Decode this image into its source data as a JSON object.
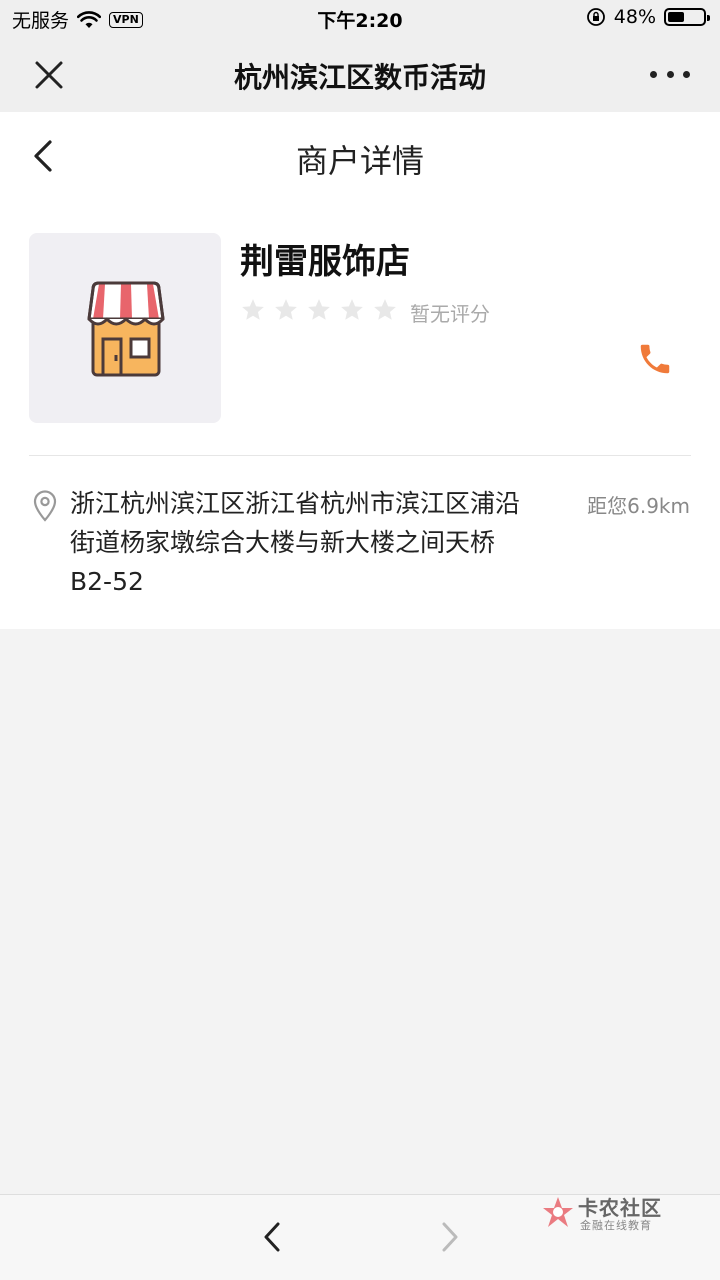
{
  "status_bar": {
    "carrier": "无服务",
    "vpn": "VPN",
    "time": "下午2:20",
    "battery_text": "48%",
    "battery_level": 0.48
  },
  "title_bar": {
    "title": "杭州滨江区数币活动",
    "close_icon": "close-icon",
    "more_icon": "more-icon"
  },
  "page": {
    "title": "商户详情"
  },
  "store": {
    "name": "荆雷服饰店",
    "rating_label": "暂无评分",
    "rating_stars": 0,
    "max_stars": 5,
    "address": "浙江杭州滨江区浙江省杭州市滨江区浦沿街道杨家墩综合大楼与新大楼之间天桥B2-52",
    "distance": "距您6.9km"
  },
  "watermark": {
    "title": "卡农社区",
    "subtitle": "金融在线教育"
  },
  "colors": {
    "accent_orange": "#f07a3a",
    "star_grey": "#e8e8e8",
    "background": "#f3f3f3"
  }
}
